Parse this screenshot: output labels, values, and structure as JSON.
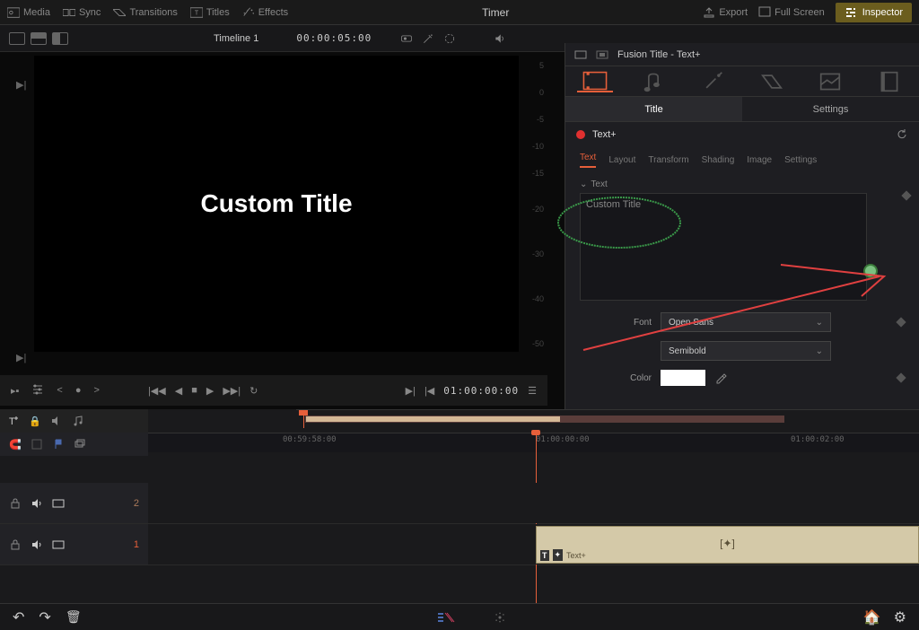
{
  "topbar": {
    "media": "Media",
    "sync": "Sync",
    "transitions": "Transitions",
    "titles": "Titles",
    "effects": "Effects",
    "center": "Timer",
    "export": "Export",
    "fullscreen": "Full Screen",
    "inspector": "Inspector"
  },
  "secondbar": {
    "timeline_name": "Timeline 1",
    "timecode": "00:00:05:00"
  },
  "viewer": {
    "text": "Custom Title",
    "ruler": [
      "5",
      "0",
      "-5",
      "-10",
      "-15",
      "-20",
      "-30",
      "-40",
      "-50"
    ]
  },
  "transport": {
    "timecode": "01:00:00:00"
  },
  "inspector": {
    "header": "Fusion Title - Text+",
    "tab_title": "Title",
    "tab_settings": "Settings",
    "node": "Text+",
    "subtabs": [
      "Text",
      "Layout",
      "Transform",
      "Shading",
      "Image",
      "Settings"
    ],
    "section_text": "Text",
    "text_value": "Custom Title",
    "font_label": "Font",
    "font_value": "Open Sans",
    "weight_value": "Semibold",
    "color_label": "Color",
    "color_value": "#ffffff"
  },
  "timeline": {
    "ticks": [
      "00:59:58:00",
      "01:00:00:00",
      "01:00:02:00"
    ],
    "tracks": [
      {
        "num": "2"
      },
      {
        "num": "1"
      }
    ],
    "clip": {
      "label": "Text+"
    }
  }
}
